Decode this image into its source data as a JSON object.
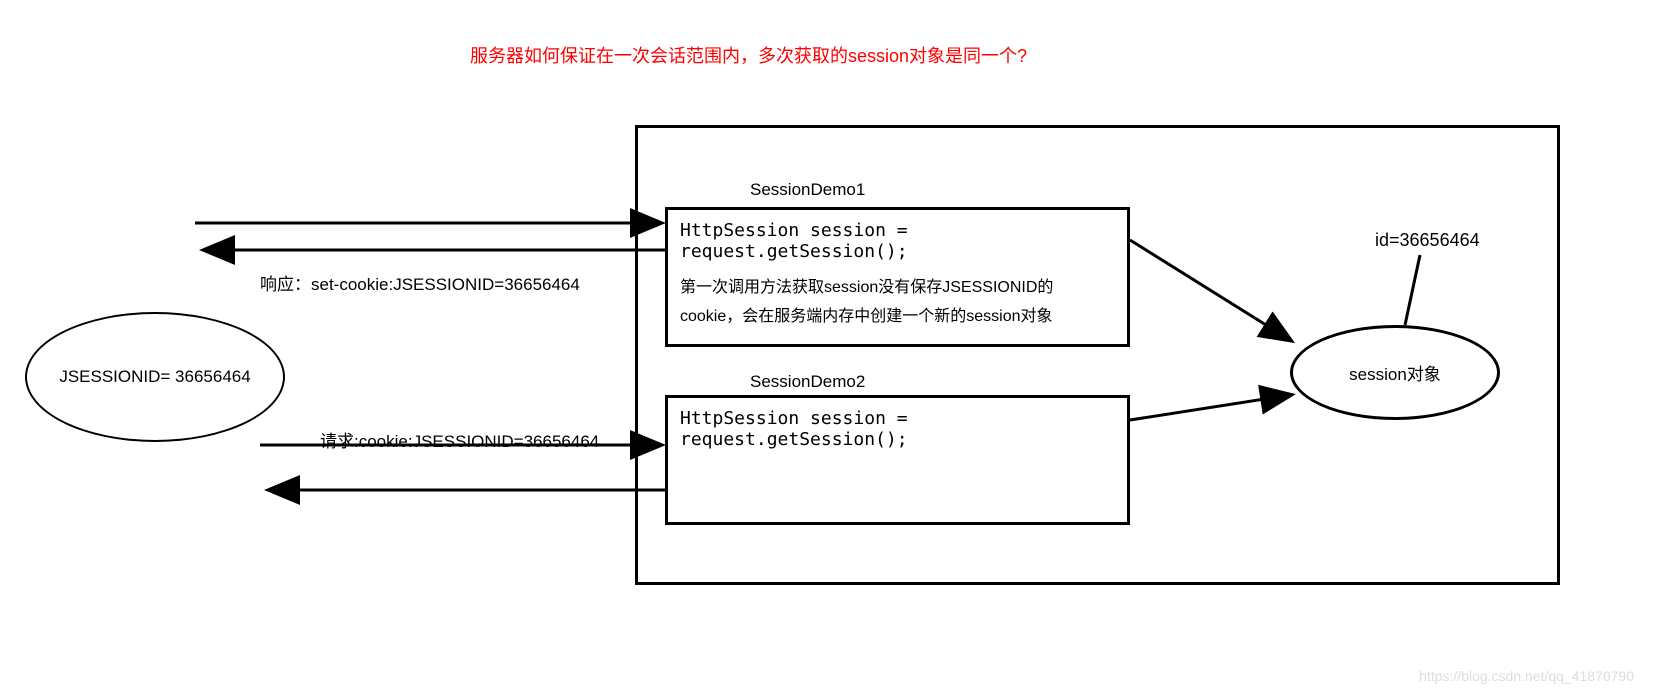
{
  "title": "服务器如何保证在一次会话范围内，多次获取的session对象是同一个?",
  "client": {
    "label": "JSESSIONID= 36656464"
  },
  "server": {
    "demo1": {
      "label": "SessionDemo1",
      "code": "HttpSession session = request.getSession();",
      "desc": "第一次调用方法获取session没有保存JSESSIONID的cookie，会在服务端内存中创建一个新的session对象"
    },
    "demo2": {
      "label": "SessionDemo2",
      "code": "HttpSession session = request.getSession();"
    },
    "sessionObject": {
      "label": "session对象",
      "idLabel": "id=36656464"
    }
  },
  "flows": {
    "response": "响应：set-cookie:JSESSIONID=36656464",
    "request": "请求:cookie:JSESSIONID=36656464"
  },
  "watermark": "https://blog.csdn.net/qq_41870790"
}
